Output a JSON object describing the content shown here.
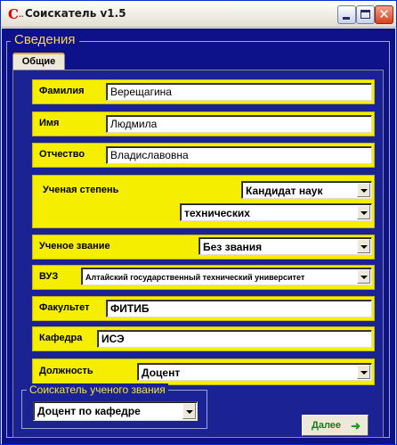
{
  "window": {
    "title": "Соискатель v1.5",
    "icon_glyph": "С",
    "icon_sub": "··",
    "close_glyph": "✕"
  },
  "group": {
    "legend": "Сведения"
  },
  "tab": {
    "label": "Общие"
  },
  "fields": {
    "surname": {
      "label": "Фамилия",
      "value": "Верещагина"
    },
    "name": {
      "label": "Имя",
      "value": "Людмила"
    },
    "patronymic": {
      "label": "Отчество",
      "value": "Владиславовна"
    },
    "degree": {
      "label": "Ученая степень",
      "value": "Кандидат наук",
      "field_value": "технических"
    },
    "rank": {
      "label": "Ученое звание",
      "value": "Без звания"
    },
    "university": {
      "label": "ВУЗ",
      "value": "Алтайский государственный технический университет"
    },
    "faculty": {
      "label": "Факультет",
      "value": "ФИТИБ"
    },
    "department": {
      "label": "Кафедра",
      "value": "ИСЭ"
    },
    "position": {
      "label": "Должность",
      "value": "Доцент"
    }
  },
  "applicant": {
    "legend": "Соискатель ученого звания",
    "value": "Доцент по кафедре"
  },
  "buttons": {
    "next_label": "Далее",
    "next_icon": "➜"
  },
  "colors": {
    "background": "#0d118a",
    "row_yellow": "#f6ee00",
    "legend_yellow": "#f8d84a"
  },
  "icons": [
    "app-icon",
    "minimize-icon",
    "maximize-icon",
    "close-icon",
    "dropdown-arrow-icon",
    "arrow-right-icon"
  ]
}
